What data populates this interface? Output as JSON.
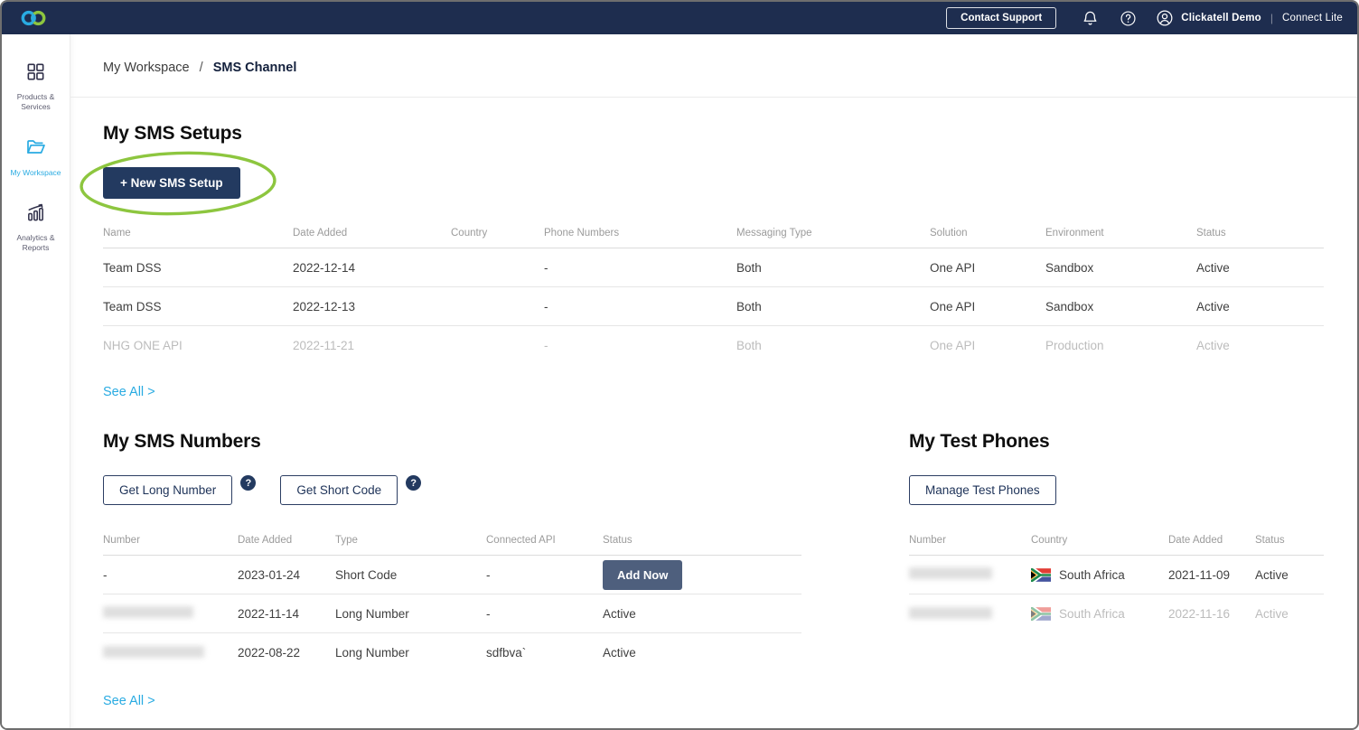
{
  "topbar": {
    "contact_support_label": "Contact Support",
    "user_name": "Clickatell Demo",
    "divider": "|",
    "product_name": "Connect Lite",
    "icons": [
      "clickatell-logo",
      "bell-icon",
      "help-icon",
      "user-icon"
    ]
  },
  "sidebar": {
    "items": [
      {
        "label": "Products & Services",
        "icon": "grid-icon",
        "active": false
      },
      {
        "label": "My Workspace",
        "icon": "folder-icon",
        "active": true
      },
      {
        "label": "Analytics & Reports",
        "icon": "analytics-icon",
        "active": false
      }
    ]
  },
  "breadcrumb": {
    "parent": "My Workspace",
    "separator": "/",
    "current": "SMS Channel"
  },
  "sms_setups": {
    "title": "My SMS Setups",
    "new_button_label": "+ New SMS Setup",
    "columns": [
      "Name",
      "Date Added",
      "Country",
      "Phone Numbers",
      "Messaging Type",
      "Solution",
      "Environment",
      "Status"
    ],
    "rows": [
      {
        "name": "Team DSS",
        "date_added": "2022-12-14",
        "country": "",
        "phone_numbers": "-",
        "messaging_type": "Both",
        "solution": "One API",
        "environment": "Sandbox",
        "status": "Active",
        "faded": false
      },
      {
        "name": "Team DSS",
        "date_added": "2022-12-13",
        "country": "",
        "phone_numbers": "-",
        "messaging_type": "Both",
        "solution": "One API",
        "environment": "Sandbox",
        "status": "Active",
        "faded": false
      },
      {
        "name": "NHG ONE API",
        "date_added": "2022-11-21",
        "country": "",
        "phone_numbers": "-",
        "messaging_type": "Both",
        "solution": "One API",
        "environment": "Production",
        "status": "Active",
        "faded": true
      }
    ],
    "see_all_label": "See All >"
  },
  "sms_numbers": {
    "title": "My SMS Numbers",
    "get_long_number_label": "Get Long Number",
    "get_short_code_label": "Get Short Code",
    "help_badge": "?",
    "columns": [
      "Number",
      "Date Added",
      "Type",
      "Connected API",
      "Status"
    ],
    "rows": [
      {
        "number": "-",
        "number_redacted": false,
        "date_added": "2023-01-24",
        "type": "Short Code",
        "connected_api": "-",
        "status": "Add Now",
        "status_is_button": true
      },
      {
        "number": "",
        "number_redacted": true,
        "date_added": "2022-11-14",
        "type": "Long Number",
        "connected_api": "-",
        "status": "Active",
        "status_is_button": false
      },
      {
        "number": "",
        "number_redacted": true,
        "date_added": "2022-08-22",
        "type": "Long Number",
        "connected_api": "sdfbva`",
        "status": "Active",
        "status_is_button": false
      }
    ],
    "see_all_label": "See All >"
  },
  "test_phones": {
    "title": "My Test Phones",
    "manage_button_label": "Manage Test Phones",
    "columns": [
      "Number",
      "Country",
      "Date Added",
      "Status"
    ],
    "rows": [
      {
        "number": "",
        "number_redacted": true,
        "country": "South Africa",
        "country_flag": "south-africa-flag",
        "date_added": "2021-11-09",
        "status": "Active",
        "faded": false
      },
      {
        "number": "",
        "number_redacted": true,
        "country": "South Africa",
        "country_flag": "south-africa-flag",
        "date_added": "2022-11-16",
        "status": "Active",
        "faded": true
      }
    ]
  },
  "colors": {
    "topbar_navy": "#1e2d4f",
    "primary_button_navy": "#233a60",
    "addnow_slate": "#4e5f7d",
    "accent_blue": "#29abe2",
    "annotation_green": "#8dc63f"
  }
}
